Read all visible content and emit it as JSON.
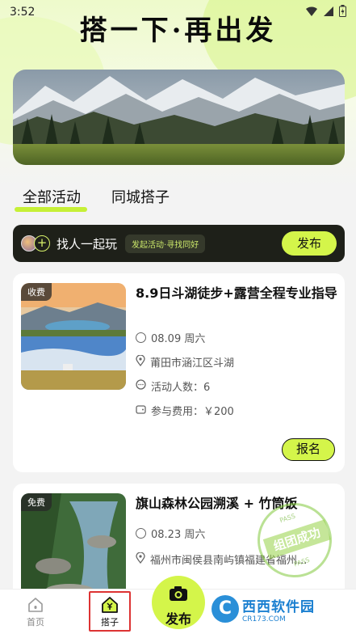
{
  "status_bar": {
    "time": "3:52"
  },
  "headline": "搭一下·再出发",
  "tabs": [
    {
      "label": "全部活动",
      "active": true
    },
    {
      "label": "同城搭子",
      "active": false
    }
  ],
  "find_bar": {
    "text": "找人一起玩",
    "tag": "发起活动·寻找同好",
    "button": "发布"
  },
  "activities": [
    {
      "fee_badge": "收费",
      "title": "8.9日斗湖徒步+露营全程专业指导",
      "date": "08.09 周六",
      "location": "莆田市涵江区斗湖",
      "people": "活动人数：6",
      "fee": "参与费用：￥200",
      "action": "报名"
    },
    {
      "fee_badge": "免费",
      "title": "旗山森林公园溯溪 + 竹筒饭",
      "date": "08.23 周六",
      "location": "福州市闽侯县南屿镇福建省福州...",
      "stamp": {
        "main": "组团成功",
        "small": "PASS"
      }
    }
  ],
  "bottom_nav": {
    "home": "首页",
    "partner": "搭子",
    "fab": "发布"
  },
  "watermark": {
    "main": "西西软件园",
    "sub": "CR173.COM",
    "logo": "C"
  },
  "colors": {
    "accent": "#d4f54a",
    "dark_bar": "#1e2019",
    "highlight": "#c6f036"
  }
}
